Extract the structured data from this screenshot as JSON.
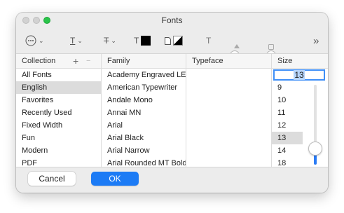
{
  "window": {
    "title": "Fonts"
  },
  "toolbar": {
    "overflow_glyph": "»",
    "items": [
      {
        "icon": "actions-menu-icon"
      },
      {
        "icon": "text-underline-icon",
        "glyph": "T"
      },
      {
        "icon": "text-strikethrough-icon",
        "glyph": "T"
      },
      {
        "icon": "text-color-icon",
        "glyph": "T",
        "color": "#000000"
      },
      {
        "icon": "document-color-icon",
        "color": "#000000"
      },
      {
        "icon": "text-shadow-icon",
        "glyph": "T"
      }
    ]
  },
  "columns": {
    "collection": {
      "header": "Collection",
      "add_glyph": "+",
      "remove_glyph": "−",
      "items": [
        "All Fonts",
        "English",
        "Favorites",
        "Recently Used",
        "Fixed Width",
        "Fun",
        "Modern",
        "PDF"
      ],
      "selected": "English"
    },
    "family": {
      "header": "Family",
      "items": [
        "Academy Engraved LET",
        "American Typewriter",
        "Andale Mono",
        "Annai MN",
        "Arial",
        "Arial Black",
        "Arial Narrow",
        "Arial Rounded MT Bold"
      ]
    },
    "typeface": {
      "header": "Typeface",
      "items": []
    },
    "size": {
      "header": "Size",
      "value": "13",
      "items": [
        "9",
        "10",
        "11",
        "12",
        "13",
        "14",
        "18"
      ],
      "selected": "13",
      "slider_fraction": 0.2
    }
  },
  "buttons": {
    "cancel": "Cancel",
    "ok": "OK"
  },
  "colors": {
    "accent": "#1c7bf5",
    "selection": "#dcdcdc"
  }
}
